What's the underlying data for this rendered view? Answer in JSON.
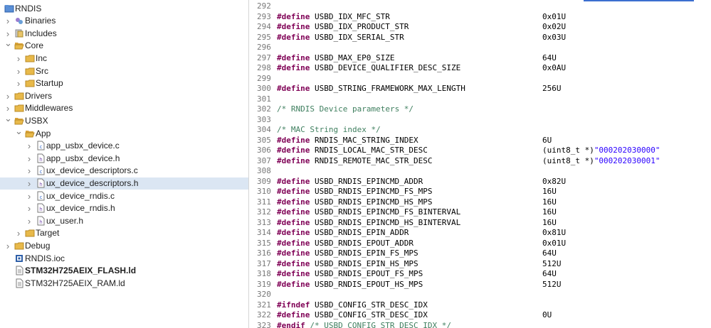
{
  "tree": [
    {
      "label": "RNDIS",
      "depth": 0,
      "chevron": "",
      "icon": "project-icon",
      "selected": false,
      "bold": false
    },
    {
      "label": "Binaries",
      "depth": 1,
      "chevron": "right",
      "icon": "binaries-icon",
      "selected": false,
      "bold": false
    },
    {
      "label": "Includes",
      "depth": 1,
      "chevron": "right",
      "icon": "includes-icon",
      "selected": false,
      "bold": false
    },
    {
      "label": "Core",
      "depth": 1,
      "chevron": "down",
      "icon": "folder-open-icon",
      "selected": false,
      "bold": false
    },
    {
      "label": "Inc",
      "depth": 2,
      "chevron": "right",
      "icon": "folder-icon",
      "selected": false,
      "bold": false
    },
    {
      "label": "Src",
      "depth": 2,
      "chevron": "right",
      "icon": "folder-icon",
      "selected": false,
      "bold": false
    },
    {
      "label": "Startup",
      "depth": 2,
      "chevron": "right",
      "icon": "folder-icon",
      "selected": false,
      "bold": false
    },
    {
      "label": "Drivers",
      "depth": 1,
      "chevron": "right",
      "icon": "folder-icon",
      "selected": false,
      "bold": false
    },
    {
      "label": "Middlewares",
      "depth": 1,
      "chevron": "right",
      "icon": "folder-icon",
      "selected": false,
      "bold": false
    },
    {
      "label": "USBX",
      "depth": 1,
      "chevron": "down",
      "icon": "folder-open-icon",
      "selected": false,
      "bold": false
    },
    {
      "label": "App",
      "depth": 2,
      "chevron": "down",
      "icon": "folder-open-icon",
      "selected": false,
      "bold": false
    },
    {
      "label": "app_usbx_device.c",
      "depth": 3,
      "chevron": "right",
      "icon": "c-file-icon",
      "selected": false,
      "bold": false
    },
    {
      "label": "app_usbx_device.h",
      "depth": 3,
      "chevron": "right",
      "icon": "h-file-icon",
      "selected": false,
      "bold": false
    },
    {
      "label": "ux_device_descriptors.c",
      "depth": 3,
      "chevron": "right",
      "icon": "c-file-icon",
      "selected": false,
      "bold": false
    },
    {
      "label": "ux_device_descriptors.h",
      "depth": 3,
      "chevron": "right",
      "icon": "h-file-icon",
      "selected": true,
      "bold": false
    },
    {
      "label": "ux_device_rndis.c",
      "depth": 3,
      "chevron": "right",
      "icon": "c-file-icon",
      "selected": false,
      "bold": false
    },
    {
      "label": "ux_device_rndis.h",
      "depth": 3,
      "chevron": "right",
      "icon": "h-file-icon",
      "selected": false,
      "bold": false
    },
    {
      "label": "ux_user.h",
      "depth": 3,
      "chevron": "right",
      "icon": "h-file-icon",
      "selected": false,
      "bold": false
    },
    {
      "label": "Target",
      "depth": 2,
      "chevron": "right",
      "icon": "folder-icon",
      "selected": false,
      "bold": false
    },
    {
      "label": "Debug",
      "depth": 1,
      "chevron": "right",
      "icon": "folder-icon",
      "selected": false,
      "bold": false
    },
    {
      "label": "RNDIS.ioc",
      "depth": 1,
      "chevron": "",
      "icon": "ioc-file-icon",
      "selected": false,
      "bold": false
    },
    {
      "label": "STM32H725AEIX_FLASH.ld",
      "depth": 1,
      "chevron": "",
      "icon": "ld-file-icon",
      "selected": false,
      "bold": true
    },
    {
      "label": "STM32H725AEIX_RAM.ld",
      "depth": 1,
      "chevron": "",
      "icon": "ld-file-icon",
      "selected": false,
      "bold": false
    }
  ],
  "code": [
    {
      "n": "292",
      "kind": "empty"
    },
    {
      "n": "293",
      "kind": "define",
      "name": "USBD_IDX_MFC_STR",
      "value": "0x01U"
    },
    {
      "n": "294",
      "kind": "define",
      "name": "USBD_IDX_PRODUCT_STR",
      "value": "0x02U"
    },
    {
      "n": "295",
      "kind": "define",
      "name": "USBD_IDX_SERIAL_STR",
      "value": "0x03U"
    },
    {
      "n": "296",
      "kind": "empty"
    },
    {
      "n": "297",
      "kind": "define",
      "name": "USBD_MAX_EP0_SIZE",
      "value": "64U"
    },
    {
      "n": "298",
      "kind": "define",
      "name": "USBD_DEVICE_QUALIFIER_DESC_SIZE",
      "value": "0x0AU"
    },
    {
      "n": "299",
      "kind": "empty"
    },
    {
      "n": "300",
      "kind": "define",
      "name": "USBD_STRING_FRAMEWORK_MAX_LENGTH",
      "value": "256U"
    },
    {
      "n": "301",
      "kind": "empty"
    },
    {
      "n": "302",
      "kind": "comment",
      "text": "/* RNDIS Device parameters */"
    },
    {
      "n": "303",
      "kind": "empty"
    },
    {
      "n": "304",
      "kind": "comment",
      "text": "/* MAC String index */"
    },
    {
      "n": "305",
      "kind": "define",
      "name": "RNDIS_MAC_STRING_INDEX",
      "value": "6U"
    },
    {
      "n": "306",
      "kind": "define_str",
      "name": "RNDIS_LOCAL_MAC_STR_DESC",
      "cast": "(uint8_t *)",
      "str": "\"000202030000\""
    },
    {
      "n": "307",
      "kind": "define_str",
      "name": "RNDIS_REMOTE_MAC_STR_DESC",
      "cast": "(uint8_t *)",
      "str": "\"000202030001\""
    },
    {
      "n": "308",
      "kind": "empty"
    },
    {
      "n": "309",
      "kind": "define",
      "name": "USBD_RNDIS_EPINCMD_ADDR",
      "value": "0x82U"
    },
    {
      "n": "310",
      "kind": "define",
      "name": "USBD_RNDIS_EPINCMD_FS_MPS",
      "value": "16U"
    },
    {
      "n": "311",
      "kind": "define",
      "name": "USBD_RNDIS_EPINCMD_HS_MPS",
      "value": "16U"
    },
    {
      "n": "312",
      "kind": "define",
      "name": "USBD_RNDIS_EPINCMD_FS_BINTERVAL",
      "value": "16U"
    },
    {
      "n": "313",
      "kind": "define",
      "name": "USBD_RNDIS_EPINCMD_HS_BINTERVAL",
      "value": "16U"
    },
    {
      "n": "314",
      "kind": "define",
      "name": "USBD_RNDIS_EPIN_ADDR",
      "value": "0x81U"
    },
    {
      "n": "315",
      "kind": "define",
      "name": "USBD_RNDIS_EPOUT_ADDR",
      "value": "0x01U"
    },
    {
      "n": "316",
      "kind": "define",
      "name": "USBD_RNDIS_EPIN_FS_MPS",
      "value": "64U"
    },
    {
      "n": "317",
      "kind": "define",
      "name": "USBD_RNDIS_EPIN_HS_MPS",
      "value": "512U"
    },
    {
      "n": "318",
      "kind": "define",
      "name": "USBD_RNDIS_EPOUT_FS_MPS",
      "value": "64U"
    },
    {
      "n": "319",
      "kind": "define",
      "name": "USBD_RNDIS_EPOUT_HS_MPS",
      "value": "512U"
    },
    {
      "n": "320",
      "kind": "empty"
    },
    {
      "n": "321",
      "kind": "ifndef",
      "kw": "#ifndef",
      "name": "USBD_CONFIG_STR_DESC_IDX"
    },
    {
      "n": "322",
      "kind": "define",
      "name": "USBD_CONFIG_STR_DESC_IDX",
      "value": "0U"
    },
    {
      "n": "323",
      "kind": "endif",
      "kw": "#endif",
      "text": "/* USBD_CONFIG_STR_DESC_IDX */"
    }
  ],
  "define_kw": "#define",
  "colors": {
    "keyword": "#7f0055",
    "comment": "#3f7f5f",
    "string": "#2a00ff",
    "selection": "#dbe6f3",
    "folder": "#e8b94a",
    "line_number": "#787878"
  }
}
